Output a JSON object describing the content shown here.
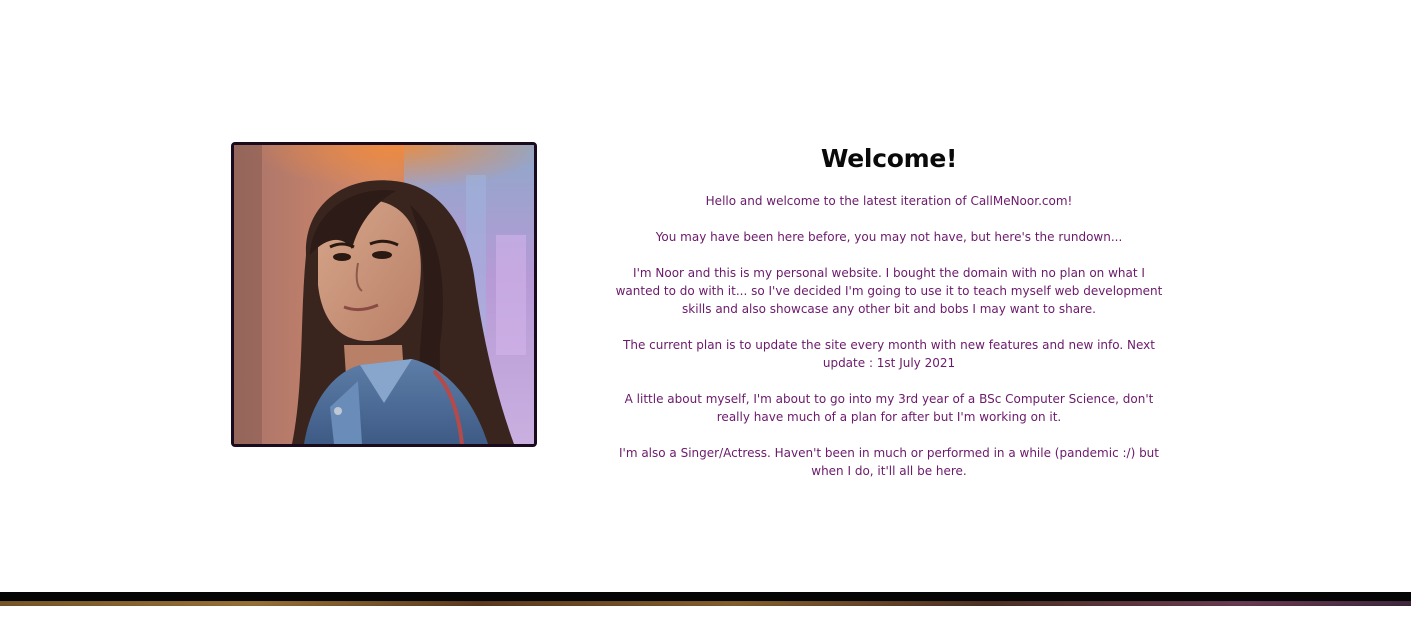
{
  "welcome": {
    "title": "Welcome!",
    "paragraphs": [
      "Hello and welcome to the latest iteration of CallMeNoor.com!",
      "You may have been here before, you may not have, but here's the rundown...",
      "I'm Noor and this is my personal website. I bought the domain with no plan on what I wanted to do with it... so I've decided I'm going to use it to teach myself web development skills and also showcase any other bit and bobs I may want to share.",
      "The current plan is to update the site every month with new features and new info. Next update : 1st July 2021",
      "A little about myself, I'm about to go into my 3rd year of a BSc Computer Science, don't really have much of a plan for after but I'm working on it.",
      "I'm also a Singer/Actress. Haven't been in much or performed in a while (pandemic :/) but when I do, it'll all be here."
    ]
  },
  "photo": {
    "subject": "portrait-photo",
    "border_color": "#1a0a1e"
  },
  "colors": {
    "title": "#0a0a0a",
    "body_text": "#6b1a6b",
    "background": "#ffffff",
    "footer": "#050505"
  }
}
